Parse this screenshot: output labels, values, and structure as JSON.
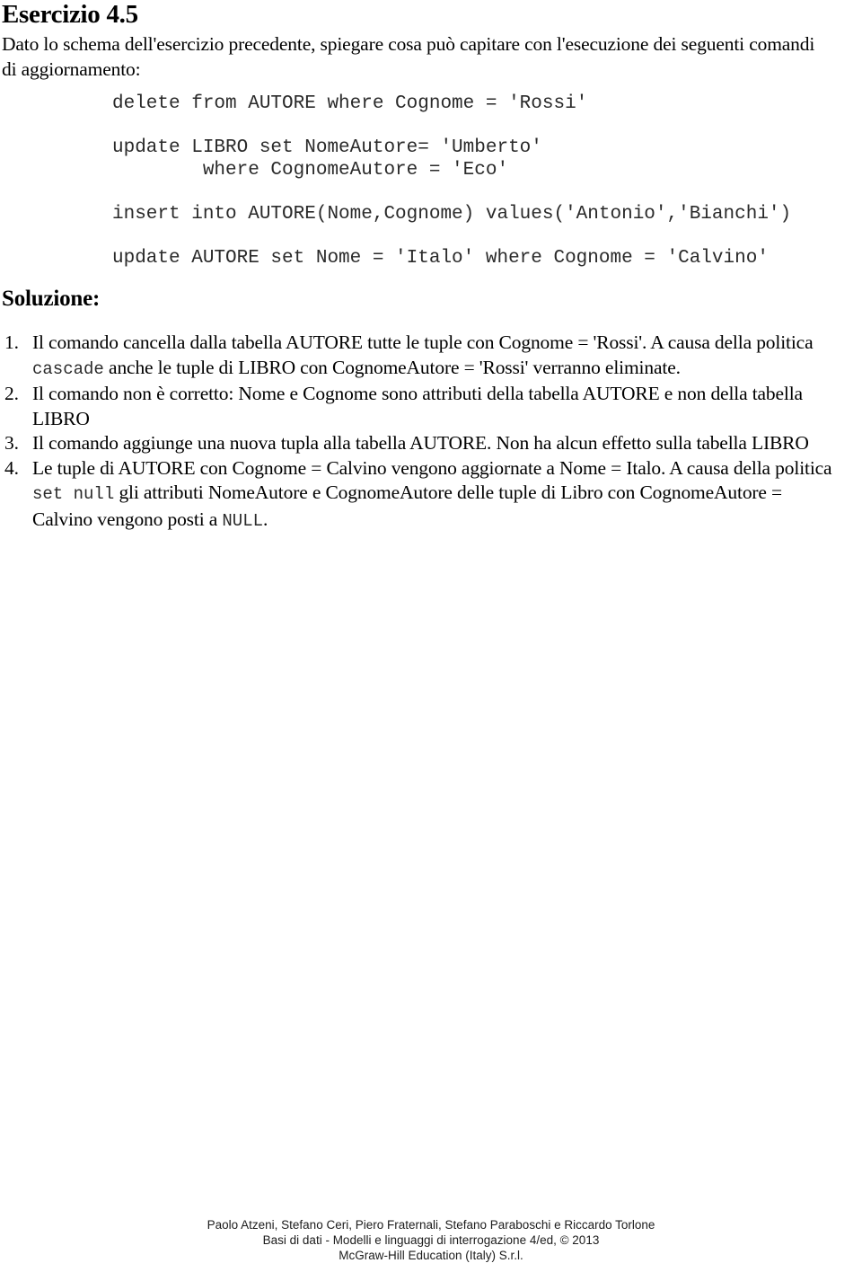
{
  "document": {
    "title": "Esercizio 4.5",
    "intro": "Dato lo schema dell'esercizio precedente, spiegare cosa può capitare con l'esecuzione dei seguenti comandi di aggiornamento:",
    "code_lines": [
      "delete from AUTORE where Cognome = 'Rossi'",
      "",
      "update LIBRO set NomeAutore= 'Umberto'",
      "        where CognomeAutore = 'Eco'",
      "",
      "insert into AUTORE(Nome,Cognome) values('Antonio','Bianchi')",
      "",
      "update AUTORE set Nome = 'Italo' where Cognome = 'Calvino'"
    ],
    "solution_heading": "Soluzione:",
    "solution_items": [
      {
        "marker": "1.",
        "parts": [
          {
            "type": "text",
            "value": "Il comando cancella dalla tabella AUTORE tutte le tuple con Cognome = 'Rossi'. A causa della politica "
          },
          {
            "type": "code",
            "value": "cascade"
          },
          {
            "type": "text",
            "value": " anche le tuple di LIBRO con CognomeAutore = 'Rossi' verranno eliminate."
          }
        ]
      },
      {
        "marker": "2.",
        "parts": [
          {
            "type": "text",
            "value": "Il comando non è corretto: Nome e Cognome sono attributi della tabella AUTORE e non della tabella LIBRO"
          }
        ]
      },
      {
        "marker": "3.",
        "parts": [
          {
            "type": "text",
            "value": "Il comando aggiunge una nuova tupla alla tabella AUTORE. Non ha alcun effetto sulla tabella LIBRO"
          }
        ]
      },
      {
        "marker": "4.",
        "parts": [
          {
            "type": "text",
            "value": "Le tuple di AUTORE con Cognome = Calvino  vengono aggiornate a Nome = Italo. A causa della politica "
          },
          {
            "type": "code",
            "value": "set null"
          },
          {
            "type": "text",
            "value": " gli attributi NomeAutore e CognomeAutore delle tuple di Libro con CognomeAutore = Calvino  vengono posti a "
          },
          {
            "type": "code",
            "value": "NULL"
          },
          {
            "type": "text",
            "value": "."
          }
        ]
      }
    ]
  },
  "footer": {
    "line1": "Paolo Atzeni, Stefano Ceri, Piero Fraternali, Stefano Paraboschi e Riccardo Torlone",
    "line2": "Basi di dati - Modelli e linguaggi di interrogazione 4/ed, © 2013",
    "line3": "McGraw-Hill Education (Italy) S.r.l."
  }
}
